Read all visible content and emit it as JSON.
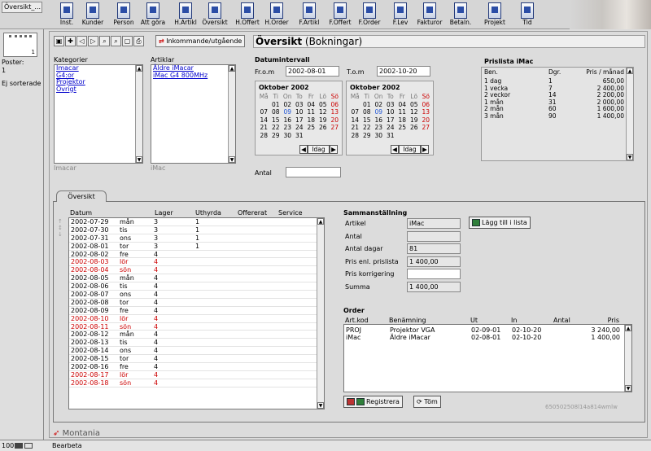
{
  "window_tab": "Översikt_...",
  "toolbar": [
    {
      "label": "Inst.",
      "icon": "settings-icon"
    },
    {
      "label": "Kunder",
      "icon": "customers-icon"
    },
    {
      "label": "Person",
      "icon": "person-icon"
    },
    {
      "label": "Att göra",
      "icon": "todo-icon"
    },
    {
      "label": "H.Artikl",
      "icon": "article-icon"
    },
    {
      "label": "Översikt",
      "icon": "overview-icon"
    },
    {
      "label": "H.Offert",
      "icon": "offer-icon"
    },
    {
      "label": "H.Order",
      "icon": "order-icon"
    },
    {
      "label": "F.Artikl",
      "icon": "article-f-icon"
    },
    {
      "label": "F.Offert",
      "icon": "offer-f-icon"
    },
    {
      "label": "F.Order",
      "icon": "order-f-icon"
    },
    {
      "label": "F.Lev",
      "icon": "delivery-icon"
    },
    {
      "label": "Fakturor",
      "icon": "invoice-icon"
    },
    {
      "label": "Betaln.",
      "icon": "payment-icon"
    },
    {
      "label": "Projekt",
      "icon": "project-icon"
    },
    {
      "label": "Tid",
      "icon": "time-icon"
    }
  ],
  "sidebar": {
    "notebook_count": "1",
    "poster_label": "Poster:",
    "poster_value": "1",
    "unsorted": "Ej sorterade"
  },
  "status": {
    "zoom": "100",
    "mode": "Bearbeta"
  },
  "header": {
    "io_button": "Inkommande/utgående",
    "title_main": "Översikt",
    "title_sub": "(Bokningar)"
  },
  "kategorier": {
    "label": "Kategorier",
    "items": [
      "Imacar",
      "G4:or",
      "Projektor",
      "Övrigt"
    ],
    "selected": "Imacar"
  },
  "artiklar": {
    "label": "Artiklar",
    "items": [
      "Äldre iMacar",
      "iMac G4 800MHz"
    ],
    "selected": "iMac"
  },
  "datumintervall": {
    "label": "Datumintervall",
    "from_label": "Fr.o.m",
    "from_value": "2002-08-01",
    "to_label": "T.o.m",
    "to_value": "2002-10-20"
  },
  "calendars": [
    {
      "title": "Oktober 2002",
      "today": "Idag"
    },
    {
      "title": "Oktober 2002",
      "today": "Idag"
    }
  ],
  "weekdays": [
    "Må",
    "Ti",
    "On",
    "To",
    "Fr",
    "Lö",
    "Sö"
  ],
  "calendar_days": [
    [
      "",
      "01",
      "02",
      "03",
      "04",
      "05",
      "06"
    ],
    [
      "07",
      "08",
      "09",
      "10",
      "11",
      "12",
      "13"
    ],
    [
      "14",
      "15",
      "16",
      "17",
      "18",
      "19",
      "20"
    ],
    [
      "21",
      "22",
      "23",
      "24",
      "25",
      "26",
      "27"
    ],
    [
      "28",
      "29",
      "30",
      "31",
      "",
      "",
      ""
    ]
  ],
  "antal": {
    "label": "Antal",
    "value": ""
  },
  "prislista": {
    "title": "Prislista iMac",
    "headers": [
      "Ben.",
      "Dgr.",
      "Pris / månad"
    ],
    "rows": [
      [
        "1 dag",
        "1",
        "650,00"
      ],
      [
        "1 vecka",
        "7",
        "2 400,00"
      ],
      [
        "2 veckor",
        "14",
        "2 200,00"
      ],
      [
        "1 mån",
        "31",
        "2 000,00"
      ],
      [
        "2 mån",
        "60",
        "1 600,00"
      ],
      [
        "3 mån",
        "90",
        "1 400,00"
      ]
    ]
  },
  "tab": {
    "label": "Översikt"
  },
  "overview": {
    "headers": [
      "Datum",
      "Lager",
      "Uthyrda",
      "Offererat",
      "Service"
    ],
    "rows": [
      {
        "date": "2002-07-29",
        "day": "mån",
        "lager": "3",
        "uthyrda": "1",
        "we": false
      },
      {
        "date": "2002-07-30",
        "day": "tis",
        "lager": "3",
        "uthyrda": "1",
        "we": false
      },
      {
        "date": "2002-07-31",
        "day": "ons",
        "lager": "3",
        "uthyrda": "1",
        "we": false
      },
      {
        "date": "2002-08-01",
        "day": "tor",
        "lager": "3",
        "uthyrda": "1",
        "we": false
      },
      {
        "date": "2002-08-02",
        "day": "fre",
        "lager": "4",
        "uthyrda": "",
        "we": false
      },
      {
        "date": "2002-08-03",
        "day": "lör",
        "lager": "4",
        "uthyrda": "",
        "we": true
      },
      {
        "date": "2002-08-04",
        "day": "sön",
        "lager": "4",
        "uthyrda": "",
        "we": true
      },
      {
        "date": "2002-08-05",
        "day": "mån",
        "lager": "4",
        "uthyrda": "",
        "we": false
      },
      {
        "date": "2002-08-06",
        "day": "tis",
        "lager": "4",
        "uthyrda": "",
        "we": false
      },
      {
        "date": "2002-08-07",
        "day": "ons",
        "lager": "4",
        "uthyrda": "",
        "we": false
      },
      {
        "date": "2002-08-08",
        "day": "tor",
        "lager": "4",
        "uthyrda": "",
        "we": false
      },
      {
        "date": "2002-08-09",
        "day": "fre",
        "lager": "4",
        "uthyrda": "",
        "we": false
      },
      {
        "date": "2002-08-10",
        "day": "lör",
        "lager": "4",
        "uthyrda": "",
        "we": true
      },
      {
        "date": "2002-08-11",
        "day": "sön",
        "lager": "4",
        "uthyrda": "",
        "we": true
      },
      {
        "date": "2002-08-12",
        "day": "mån",
        "lager": "4",
        "uthyrda": "",
        "we": false
      },
      {
        "date": "2002-08-13",
        "day": "tis",
        "lager": "4",
        "uthyrda": "",
        "we": false
      },
      {
        "date": "2002-08-14",
        "day": "ons",
        "lager": "4",
        "uthyrda": "",
        "we": false
      },
      {
        "date": "2002-08-15",
        "day": "tor",
        "lager": "4",
        "uthyrda": "",
        "we": false
      },
      {
        "date": "2002-08-16",
        "day": "fre",
        "lager": "4",
        "uthyrda": "",
        "we": false
      },
      {
        "date": "2002-08-17",
        "day": "lör",
        "lager": "4",
        "uthyrda": "",
        "we": true
      },
      {
        "date": "2002-08-18",
        "day": "sön",
        "lager": "4",
        "uthyrda": "",
        "we": true
      }
    ]
  },
  "sammanstallning": {
    "title": "Sammanställning",
    "fields": [
      {
        "label": "Artikel",
        "value": "iMac"
      },
      {
        "label": "Antal",
        "value": ""
      },
      {
        "label": "Antal dagar",
        "value": "81"
      },
      {
        "label": "Pris enl. prislista",
        "value": "1 400,00"
      },
      {
        "label": "Pris korrigering",
        "value": ""
      },
      {
        "label": "Summa",
        "value": "1 400,00"
      }
    ],
    "add_button": "Lägg till i lista"
  },
  "order": {
    "title": "Order",
    "headers": [
      "Art.kod",
      "Benämning",
      "Ut",
      "In",
      "Antal",
      "Pris"
    ],
    "rows": [
      [
        "PROJ",
        "Projektor VGA",
        "02-09-01",
        "02-10-20",
        "",
        "3 240,00"
      ],
      [
        "iMac",
        "Äldre iMacar",
        "02-08-01",
        "02-10-20",
        "",
        "1 400,00"
      ]
    ],
    "register_button": "Registrera",
    "clear_button": "Töm",
    "code": "650502508l14a814wmlw"
  },
  "logo": "Montania"
}
